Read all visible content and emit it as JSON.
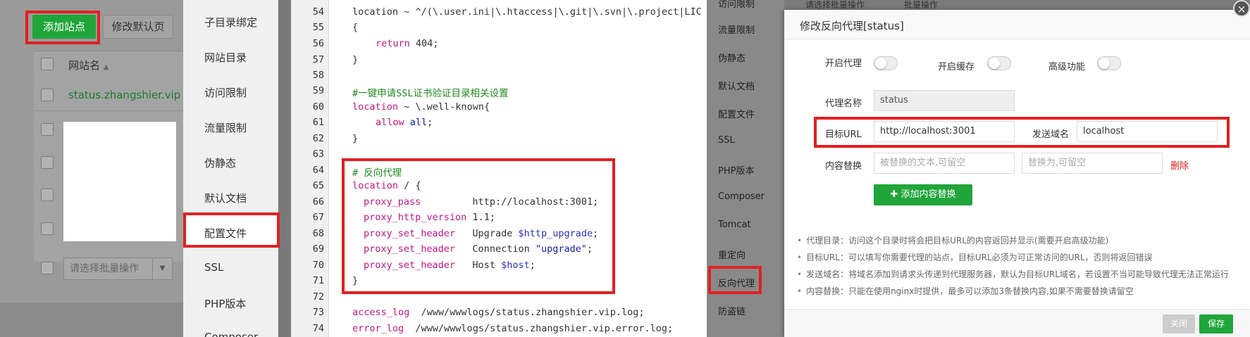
{
  "site_list": {
    "add_site_label": "添加站点",
    "modify_default_label": "修改默认页",
    "column_site_name": "网站名",
    "sort_icon": "triangle-up",
    "site_row_1": "status.zhangshier.vip",
    "batch_select_placeholder": "请选择批量操作"
  },
  "menu": {
    "items": [
      "子目录绑定",
      "网站目录",
      "访问限制",
      "流量限制",
      "伪静态",
      "默认文档",
      "配置文件",
      "SSL",
      "PHP版本",
      "Composer"
    ]
  },
  "editor": {
    "line_numbers": [
      "54",
      "55",
      "56",
      "57",
      "58",
      "59",
      "60",
      "61",
      "62",
      "63",
      "64",
      "65",
      "66",
      "67",
      "68",
      "69",
      "70",
      "71",
      "72",
      "73",
      "74"
    ],
    "lines": {
      "l54": "location ~ ^/(\\.user.ini|\\.htaccess|\\.git|\\.svn|\\.project|LIC",
      "l55": "{",
      "l56_kw": "return",
      "l56_rest": " 404;",
      "l57": "}",
      "l59": "#一键申请SSL证书验证目录相关设置",
      "l60_kw": "location",
      "l60_rest": " ~ \\.well-known{",
      "l61_kw": "allow",
      "l61_st": "all",
      "l61_rest": ";",
      "l62": "}",
      "l64": "# 反向代理",
      "l65_kw": "location",
      "l65_rest": " / {",
      "l66_kw": "proxy_pass",
      "l66_rest": "         http://localhost:3001;",
      "l67_kw": "proxy_http_version",
      "l67_rest": " 1.1;",
      "l68_kw": "proxy_set_header",
      "l68_mid": "   Upgrade ",
      "l68_var": "$http_upgrade",
      "l68_end": ";",
      "l69_kw": "proxy_set_header",
      "l69_mid": "   Connection ",
      "l69_st": "\"upgrade\"",
      "l69_end": ";",
      "l70_kw": "proxy_set_header",
      "l70_mid": "   Host ",
      "l70_var": "$host",
      "l70_end": ";",
      "l71": "}",
      "l73_kw": "access_log",
      "l73_rest": "  /www/wwwlogs/status.zhangshier.vip.log;",
      "l74_kw": "error_log",
      "l74_rest": "  /www/wwwlogs/status.zhangshier.vip.error.log;"
    }
  },
  "side_menu_dim": {
    "items": [
      "访问限制",
      "流量限制",
      "伪静态",
      "默认文档",
      "配置文件",
      "SSL",
      "PHP版本",
      "Composer",
      "Tomcat",
      "重定向",
      "反向代理",
      "防盗链"
    ]
  },
  "top_strip": {
    "batch_select": "请选择批量操作",
    "batch_btn": "批量操作"
  },
  "dialog": {
    "title": "修改反向代理[status]",
    "toggles": {
      "enable_proxy": "开启代理",
      "enable_cache": "开启缓存",
      "advanced": "高级功能"
    },
    "proxy_name_label": "代理名称",
    "proxy_name_value": "status",
    "target_url_label": "目标URL",
    "target_url_value": "http://localhost:3001",
    "send_domain_label": "发送域名",
    "send_domain_value": "localhost",
    "content_replace_label": "内容替换",
    "replace_from_placeholder": "被替换的文本,可留空",
    "replace_to_placeholder": "替换为,可留空",
    "delete_label": "删除",
    "add_replace_label": "添加内容替换",
    "tips": [
      "代理目录：访问这个目录时将会把目标URL的内容返回并显示(需要开启高级功能)",
      "目标URL：可以填写你需要代理的站点，目标URL必须为可正常访问的URL，否则将返回错误",
      "发送域名：将域名添加到请求头传递到代理服务器，默认为目标URL域名，若设置不当可能导致代理无法正常运行",
      "内容替换：只能在使用nginx时提供，最多可以添加3条替换内容,如果不需要替换请留空"
    ],
    "close_label": "关闭",
    "save_label": "保存"
  }
}
